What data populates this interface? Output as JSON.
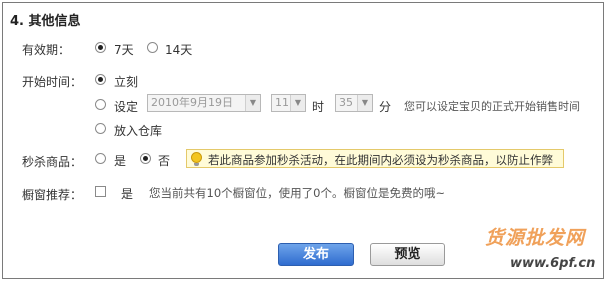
{
  "section": {
    "title": "4. 其他信息"
  },
  "validity": {
    "label": "有效期：",
    "options": [
      {
        "label": "7天",
        "selected": true
      },
      {
        "label": "14天",
        "selected": false
      }
    ]
  },
  "start_time": {
    "label": "开始时间：",
    "immediate": {
      "label": "立刻",
      "selected": true
    },
    "scheduled": {
      "label": "设定",
      "selected": false,
      "date_value": "2010年9月19日",
      "hour_value": "11",
      "hour_unit": "时",
      "minute_value": "35",
      "minute_unit": "分",
      "hint": "您可以设定宝贝的正式开始销售时间"
    },
    "warehouse": {
      "label": "放入仓库",
      "selected": false
    }
  },
  "flash_sale": {
    "label": "秒杀商品：",
    "options": [
      {
        "label": "是",
        "selected": false
      },
      {
        "label": "否",
        "selected": true
      }
    ],
    "tip": "若此商品参加秒杀活动，在此期间内必须设为秒杀商品，以防止作弊"
  },
  "showcase": {
    "label": "橱窗推荐：",
    "checkbox_label": "是",
    "checked": false,
    "hint": "您当前共有10个橱窗位，使用了0个。橱窗位是免费的哦~"
  },
  "actions": {
    "publish": "发布",
    "preview": "预览"
  },
  "watermark": {
    "text": "货源批发网",
    "url": "www.6pf.cn"
  }
}
